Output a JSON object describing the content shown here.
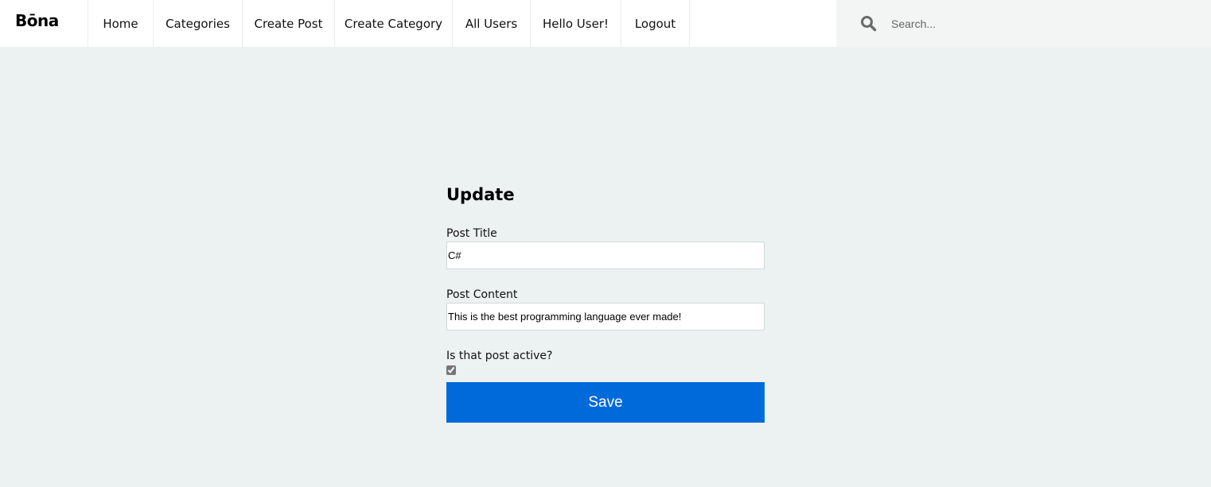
{
  "brand": {
    "name": "Bōna"
  },
  "nav": {
    "items": [
      {
        "label": "Home"
      },
      {
        "label": "Categories"
      },
      {
        "label": "Create Post"
      },
      {
        "label": "Create Category"
      },
      {
        "label": "All Users"
      },
      {
        "label": "Hello User!"
      },
      {
        "label": "Logout"
      }
    ]
  },
  "search": {
    "placeholder": "Search...",
    "icon": "search-icon"
  },
  "form": {
    "title": "Update",
    "post_title_label": "Post Title",
    "post_title_value": "C#",
    "post_content_label": "Post Content",
    "post_content_value": "This is the best programming language ever made!",
    "active_label": "Is that post active?",
    "active_checked": true,
    "save_label": "Save"
  },
  "colors": {
    "background": "#ecf1f1",
    "topbar": "#ffffff",
    "search_bg": "#f3f4f4",
    "primary": "#006adb"
  }
}
